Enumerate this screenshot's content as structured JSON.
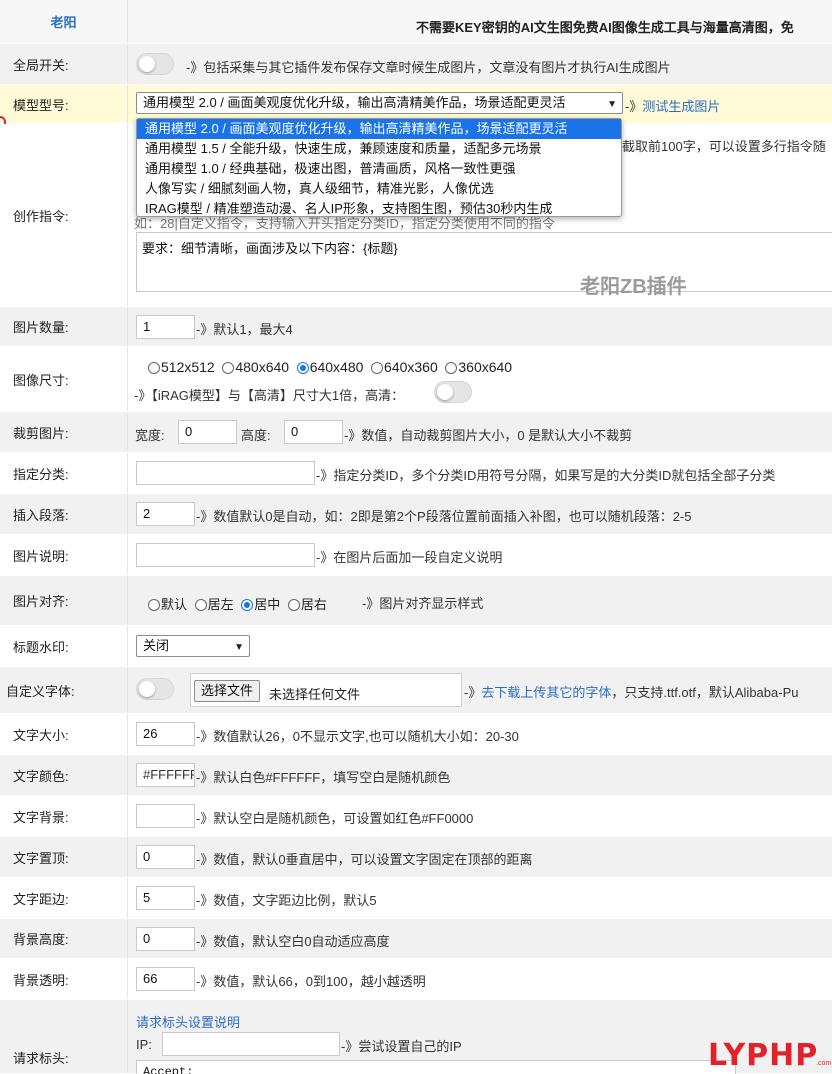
{
  "header": {
    "left": "老阳",
    "right": "不需要KEY密钥的AI文生图免费AI图像生成工具与海量高清图，免"
  },
  "global_switch": {
    "label": "全局开关:",
    "hint": "-》包括采集与其它插件发布保存文章时候生成图片，文章没有图片才执行AI生成图片"
  },
  "model": {
    "label": "模型型号:",
    "selected": "通用模型 2.0 / 画面美观度优化升级，输出高清精美作品，场景适配更灵活",
    "test_prefix": "-》",
    "test_link": "测试生成图片",
    "options": [
      "通用模型 2.0 / 画面美观度优化升级，输出高清精美作品，场景适配更灵活",
      "通用模型 1.5 / 全能升级，快速生成，兼顾速度和质量，适配多元场景",
      "通用模型 1.0 / 经典基础，极速出图，普清画质，风格一致性更强",
      "人像写实 / 细腻刻画人物，真人级细节，精准光影，人像优选",
      "IRAG模型 / 精准塑造动漫、名人IP形象，支持图生图，预估30秒内生成"
    ]
  },
  "prompt": {
    "label": "创作指令:",
    "hint_right": "截取前100字，可以设置多行指令随",
    "hint_under": "如：28|自定义指令，支持输入开头指定分类ID，指定分类使用不同的指令",
    "text": "要求：细节清晰，画面涉及以下内容：{标题}",
    "watermark": "老阳ZB插件"
  },
  "count": {
    "label": "图片数量:",
    "value": "1",
    "hint": "-》默认1，最大4"
  },
  "size": {
    "label": "图像尺寸:",
    "options": [
      "512x512",
      "480x640",
      "640x480",
      "640x360",
      "360x640"
    ],
    "selected": "640x480",
    "hint": "-》【iRAG模型】与【高清】尺寸大1倍，高清："
  },
  "crop": {
    "label": "裁剪图片:",
    "width_label": "宽度:",
    "width_value": "0",
    "height_label": "高度:",
    "height_value": "0",
    "hint": "-》数值，自动裁剪图片大小，0 是默认大小不裁剪"
  },
  "category": {
    "label": "指定分类:",
    "value": "",
    "hint": "-》指定分类ID，多个分类ID用符号分隔，如果写是的大分类ID就包括全部子分类"
  },
  "paragraph": {
    "label": "插入段落:",
    "value": "2",
    "hint": "-》数值默认0是自动，如：2即是第2个P段落位置前面插入补图，也可以随机段落：2-5"
  },
  "caption": {
    "label": "图片说明:",
    "value": "",
    "hint": "-》在图片后面加一段自定义说明"
  },
  "align": {
    "label": "图片对齐:",
    "options": [
      "默认",
      "居左",
      "居中",
      "居右"
    ],
    "selected": "居中",
    "hint": "-》图片对齐显示样式"
  },
  "title_watermark": {
    "label": "标题水印:",
    "value": "关闭"
  },
  "custom_font": {
    "label": "自定义字体:",
    "button": "选择文件",
    "no_file": "未选择任何文件",
    "hint_prefix": "-》",
    "link": "去下载上传其它的字体",
    "hint_suffix": "，只支持.ttf.otf，默认Alibaba-Pu"
  },
  "font_size": {
    "label": "文字大小:",
    "value": "26",
    "hint": "-》数值默认26，0不显示文字,也可以随机大小如：20-30"
  },
  "font_color": {
    "label": "文字颜色:",
    "value": "#FFFFFF",
    "hint": "-》默认白色#FFFFFF，填写空白是随机颜色"
  },
  "text_bg": {
    "label": "文字背景:",
    "value": "",
    "hint": "-》默认空白是随机颜色，可设置如红色#FF0000"
  },
  "text_top": {
    "label": "文字置顶:",
    "value": "0",
    "hint": "-》数值，默认0垂直居中，可以设置文字固定在顶部的距离"
  },
  "text_margin": {
    "label": "文字距边:",
    "value": "5",
    "hint": "-》数值，文字距边比例，默认5"
  },
  "bg_height": {
    "label": "背景高度:",
    "value": "0",
    "hint": "-》数值，默认空白0自动适应高度"
  },
  "bg_opacity": {
    "label": "背景透明:",
    "value": "66",
    "hint": "-》数值，默认66，0到100，越小越透明"
  },
  "request_header": {
    "label": "请求标头:",
    "link": "请求标头设置说明",
    "ip_label": "IP:",
    "ip_value": "",
    "ip_hint": "-》尝试设置自己的IP",
    "textarea": "Accept:"
  },
  "brand": {
    "text": "LYPHP",
    "sub": ".com"
  },
  "colors": {
    "accent": "#1a73e8",
    "link": "#2a6cc9",
    "brand_red": "#e0232b",
    "header_blue": "#2a6cc9"
  }
}
